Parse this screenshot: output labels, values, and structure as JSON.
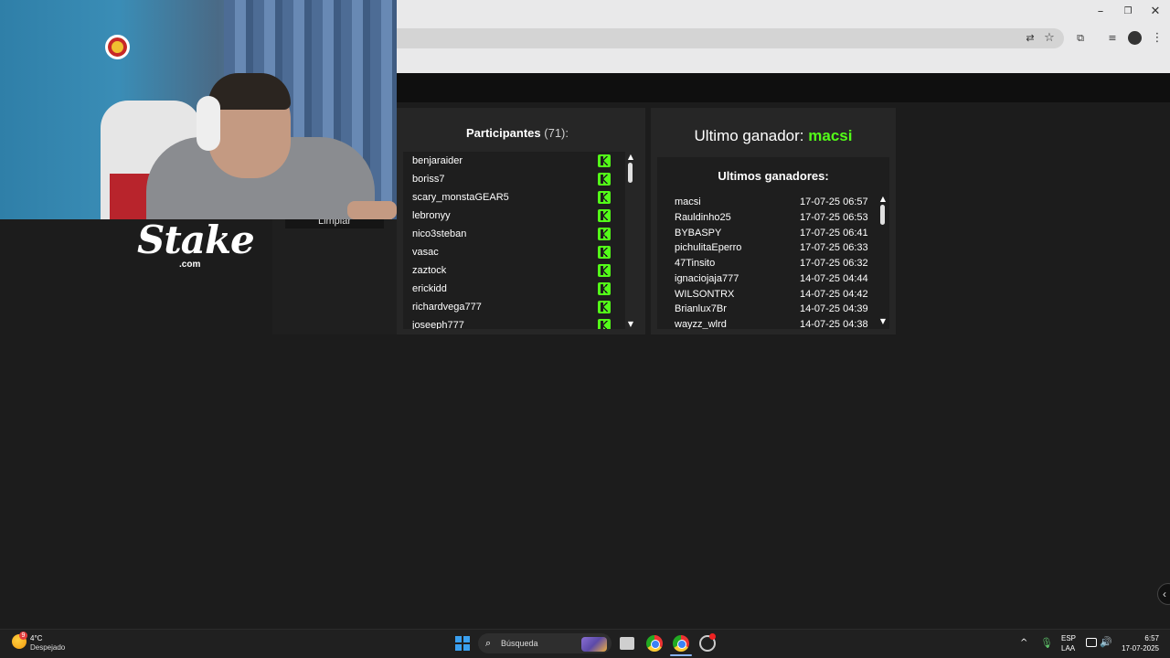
{
  "participants": {
    "title": "Participantes",
    "count": "(71):",
    "items": [
      {
        "name": "benjaraider"
      },
      {
        "name": "boriss7"
      },
      {
        "name": "scary_monstaGEAR5"
      },
      {
        "name": "lebronyy"
      },
      {
        "name": "nico3steban"
      },
      {
        "name": "vasac"
      },
      {
        "name": "zaztock"
      },
      {
        "name": "erickidd"
      },
      {
        "name": "richardvega777"
      },
      {
        "name": "joseeph777"
      }
    ],
    "platform_icon": "kick-icon",
    "platform_color": "#53fc18"
  },
  "winner": {
    "label": "Ultimo ganador:",
    "name": "macsi",
    "accent": "#53fc18"
  },
  "winners": {
    "title": "Ultimos ganadores:",
    "items": [
      {
        "name": "macsi",
        "date": "17-07-25 06:57"
      },
      {
        "name": "Rauldinho25",
        "date": "17-07-25 06:53"
      },
      {
        "name": "BYBASPY",
        "date": "17-07-25 06:41"
      },
      {
        "name": "pichulitaEperro",
        "date": "17-07-25 06:33"
      },
      {
        "name": "47Tinsito",
        "date": "17-07-25 06:32"
      },
      {
        "name": "ignaciojaja777",
        "date": "14-07-25 04:44"
      },
      {
        "name": "WILSONTRX",
        "date": "14-07-25 04:42"
      },
      {
        "name": "Brianlux7Br",
        "date": "14-07-25 04:39"
      },
      {
        "name": "wayzz_wlrd",
        "date": "14-07-25 04:38"
      }
    ]
  },
  "left_panel": {
    "clear_label": "Limpiar"
  },
  "overlay": {
    "brand": "Stake",
    "brand_suffix": ".com"
  },
  "taskbar": {
    "weather_temp": "4°C",
    "weather_desc": "Despejado",
    "weather_badge": "9",
    "search_label": "Búsqueda",
    "lang_1": "ESP",
    "lang_2": "LAA",
    "time": "6:57",
    "date": "17-07-2025"
  }
}
